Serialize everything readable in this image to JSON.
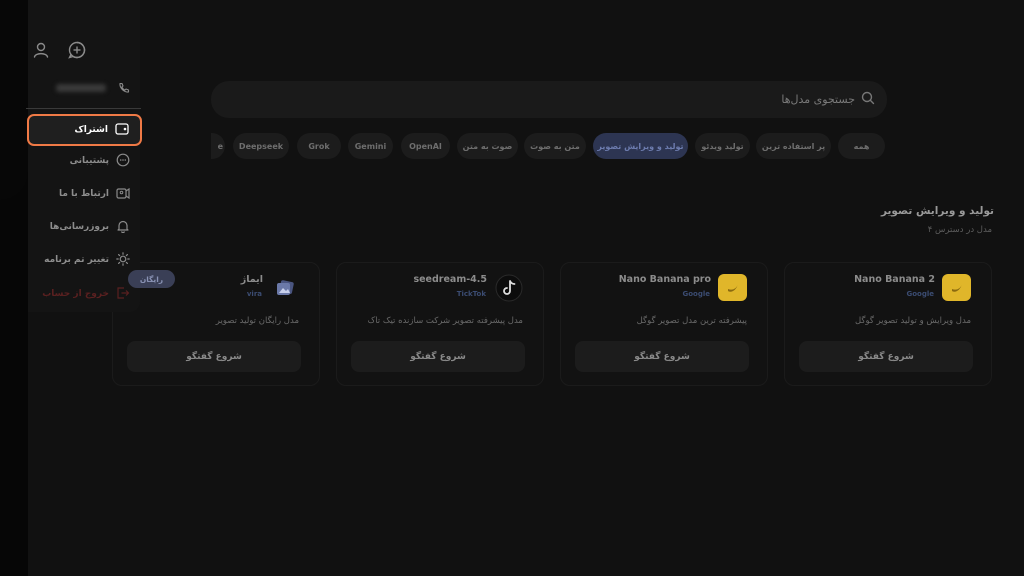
{
  "search": {
    "placeholder": "جستجوی مدل‌ها"
  },
  "tabs": [
    {
      "label": "همه",
      "selected": false
    },
    {
      "label": "پر استفاده ترین",
      "selected": false
    },
    {
      "label": "تولید ویدئو",
      "selected": false
    },
    {
      "label": "تولید و ویرایش تصویر",
      "selected": true
    },
    {
      "label": "متن به صوت",
      "selected": false
    },
    {
      "label": "صوت به متن",
      "selected": false
    },
    {
      "label": "OpenAI",
      "selected": false
    },
    {
      "label": "Gemini",
      "selected": false
    },
    {
      "label": "Grok",
      "selected": false
    },
    {
      "label": "Deepseek",
      "selected": false
    },
    {
      "label": "e",
      "selected": false
    }
  ],
  "section": {
    "title": "تولید و ویرایش تصویر",
    "subtitle": "۴ مدل در دسترس"
  },
  "cards": [
    {
      "name": "Nano Banana 2",
      "provider": "Google",
      "description": "مدل ویرایش و تولید تصویر گوگل",
      "button": "شروع گفتگو",
      "logo": "banana-icon"
    },
    {
      "name": "Nano Banana pro",
      "provider": "Google",
      "description": "پیشرفته ترین مدل تصویر گوگل",
      "button": "شروع گفتگو",
      "logo": "banana-icon"
    },
    {
      "name": "seedream-4.5",
      "provider": "TickTok",
      "description": "مدل پیشرفته تصویر شرکت سازنده تیک تاک",
      "button": "شروع گفتگو",
      "logo": "tiktok-icon"
    },
    {
      "name": "ایماژ",
      "provider": "vira",
      "description": "مدل رایگان تولید تصویر",
      "button": "شروع گفتگو",
      "logo": "image-icon",
      "badge": "رایگان"
    }
  ],
  "sidebar": {
    "items": [
      {
        "label": "اشتراک",
        "icon": "wallet-icon",
        "active": true
      },
      {
        "label": "پشتیبانی",
        "icon": "chat-bubble-icon"
      },
      {
        "label": "ارتباط با ما",
        "icon": "contact-card-icon"
      },
      {
        "label": "بروزرسانی‌ها",
        "icon": "bell-icon"
      },
      {
        "label": "تغییر تم برنامه",
        "icon": "sun-icon"
      },
      {
        "label": "خروج از حساب",
        "icon": "logout-icon"
      }
    ]
  },
  "colors": {
    "background": "#111111",
    "accent_outline": "#f07a46",
    "selected_tab": "#2d3552",
    "banana_logo": "#e0b62a"
  }
}
